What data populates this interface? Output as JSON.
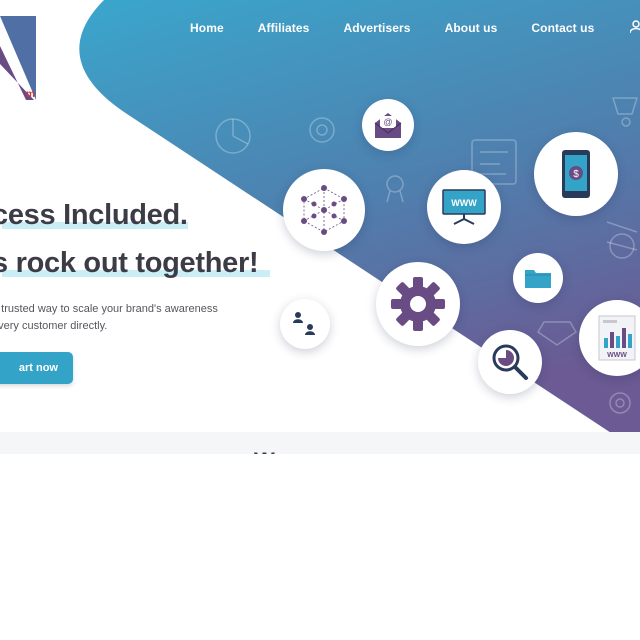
{
  "brand": {
    "logo_text": "m"
  },
  "nav": {
    "items": [
      {
        "label": "Home"
      },
      {
        "label": "Affiliates"
      },
      {
        "label": "Advertisers"
      },
      {
        "label": "About us"
      },
      {
        "label": "Contact us"
      }
    ]
  },
  "hero": {
    "headline_line1": "cess Included.",
    "headline_line2": "s rock out together!",
    "description_line1": "d trusted way to scale your brand's awareness",
    "description_line2": "every customer directly.",
    "cta_label": "art now"
  },
  "icons": {
    "www_label": "WWW",
    "chart_www_label": "WWW",
    "email_symbol": "@",
    "dollar_symbol": "$"
  },
  "section2": {
    "heading_partial": "W"
  },
  "colors": {
    "gradient_top": "#3aa6cc",
    "gradient_bottom": "#6b5a93",
    "accent_purple": "#6a4c85",
    "accent_blue": "#33a3c8",
    "logo_red": "#d2343e"
  }
}
